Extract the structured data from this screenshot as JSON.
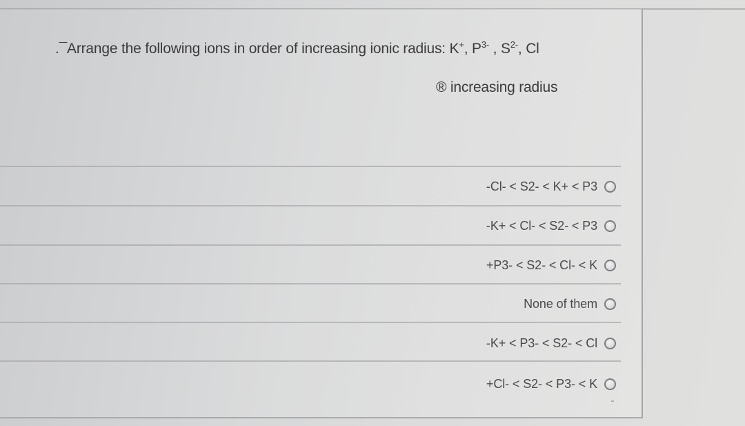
{
  "question": {
    "prefix": ".¯Arrange the following ions in order of increasing ionic radius: ",
    "ions": [
      {
        "base": "K",
        "charge": "+",
        "sep": ", "
      },
      {
        "base": "P",
        "charge": "3-",
        "sep": " , "
      },
      {
        "base": "S",
        "charge": "2-",
        "sep": ", "
      },
      {
        "base": "Cl",
        "charge": "",
        "sep": ""
      }
    ]
  },
  "subprompt": "® increasing radius",
  "options": [
    {
      "label": "-Cl- < S2- < K+ < P3",
      "selected": false
    },
    {
      "label": "-K+ < Cl- < S2- < P3",
      "selected": false
    },
    {
      "label": "+P3- < S2- < Cl- < K",
      "selected": false
    },
    {
      "label": "None of them",
      "selected": false
    },
    {
      "label": "-K+ < P3- < S2- < Cl",
      "selected": false
    },
    {
      "label": "+Cl- < S2- < P3- < K",
      "selected": false
    }
  ]
}
